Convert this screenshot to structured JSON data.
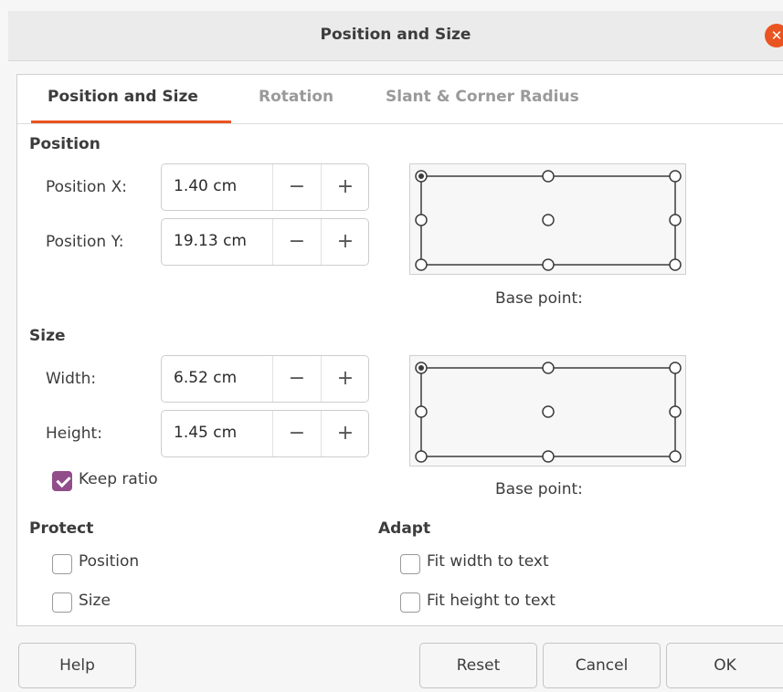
{
  "window": {
    "title": "Position and Size",
    "close_glyph": "✕"
  },
  "tabs": [
    {
      "label": "Position and Size",
      "active": true
    },
    {
      "label": "Rotation",
      "active": false
    },
    {
      "label": "Slant & Corner Radius",
      "active": false
    }
  ],
  "position": {
    "heading": "Position",
    "x_label": "Position X:",
    "x_value": "1.40 cm",
    "y_label": "Position Y:",
    "y_value": "19.13 cm",
    "base_point_label": "Base point:"
  },
  "size": {
    "heading": "Size",
    "width_label": "Width:",
    "width_value": "6.52 cm",
    "height_label": "Height:",
    "height_value": "1.45 cm",
    "keep_ratio_label": "Keep ratio",
    "keep_ratio_checked": true,
    "base_point_label": "Base point:"
  },
  "spin": {
    "minus": "−",
    "plus": "+"
  },
  "protect": {
    "heading": "Protect",
    "position_label": "Position",
    "size_label": "Size"
  },
  "adapt": {
    "heading": "Adapt",
    "fit_width_label": "Fit width to text",
    "fit_height_label": "Fit height to text"
  },
  "buttons": {
    "help": "Help",
    "reset": "Reset",
    "cancel": "Cancel",
    "ok": "OK"
  },
  "colors": {
    "accent": "#e95420",
    "checkbox_checked": "#924d8b"
  }
}
